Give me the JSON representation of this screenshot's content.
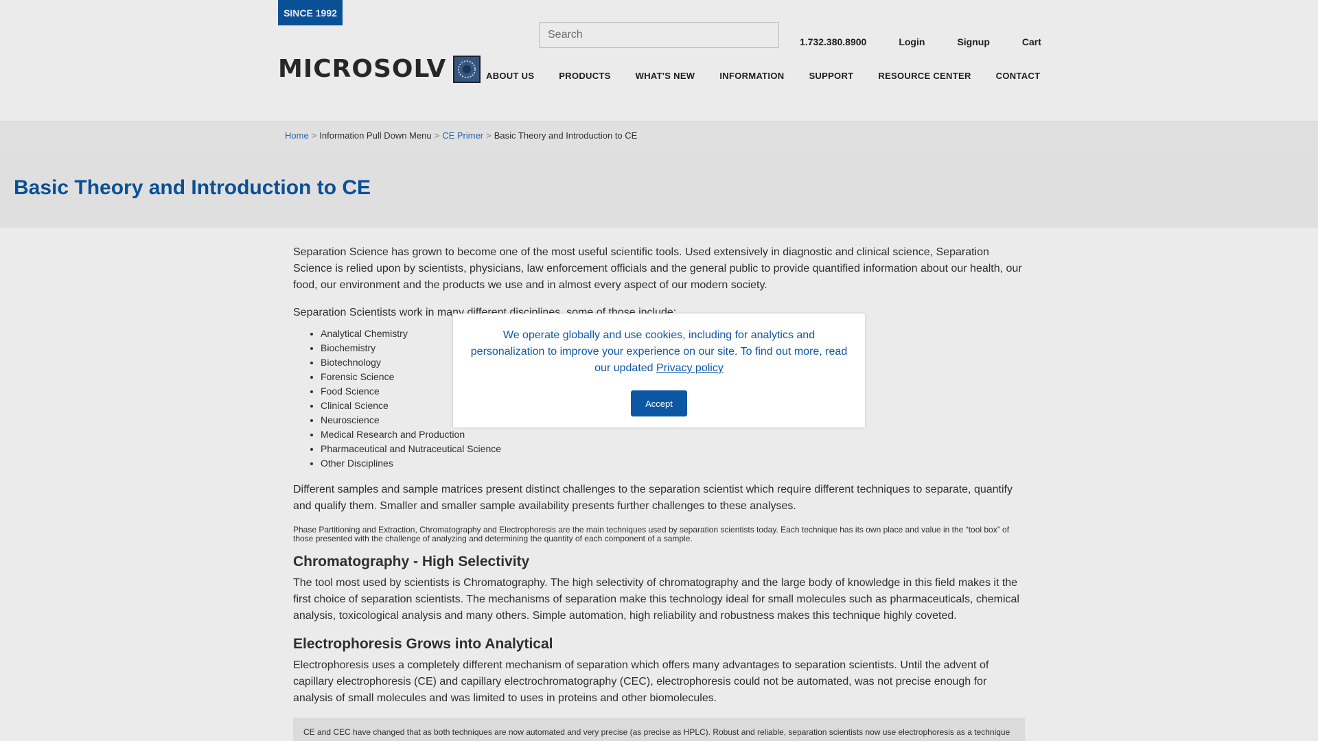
{
  "header": {
    "since_badge": "SINCE 1992",
    "logo_text": "MICROSOLV",
    "search_placeholder": "Search",
    "phone": "1.732.380.8900",
    "login": "Login",
    "signup": "Signup",
    "cart": "Cart",
    "nav": [
      "ABOUT US",
      "PRODUCTS",
      "WHAT'S NEW",
      "INFORMATION",
      "SUPPORT",
      "RESOURCE CENTER",
      "CONTACT"
    ]
  },
  "breadcrumb": {
    "home": "Home",
    "sep": ">",
    "item2": "Information Pull Down Menu",
    "item3": "CE Primer",
    "current": "Basic Theory and Introduction to CE"
  },
  "page_title": "Basic Theory and Introduction to CE",
  "content": {
    "p1": "Separation Science has grown to become one of the most useful scientific tools. Used extensively in diagnostic and clinical science, Separation Science is relied upon by scientists, physicians, law enforcement officials and the general public to provide quantified information about our health, our food, our environment and the products we use and in almost every aspect of our modern society.",
    "p2": "Separation Scientists work in many different disciplines, some of those include:",
    "disciplines": [
      "Analytical Chemistry",
      "Biochemistry",
      "Biotechnology",
      "Forensic Science",
      "Food Science",
      "Clinical Science",
      "Neuroscience",
      "Medical Research and Production",
      "Pharmaceutical and Nutraceutical Science",
      "Other Disciplines"
    ],
    "p3": "Different samples and sample matrices present distinct challenges to the separation scientist which require different techniques to separate, quantify and qualify them. Smaller and smaller sample availability presents further challenges to these analyses.",
    "p4": "Phase Partitioning and Extraction, Chromatography and Electrophoresis are the main techniques used by separation scientists today. Each technique has its own place and value in the “tool box” of those presented with the challenge of analyzing and determining the quantity of each component of a sample.",
    "h2a": "Chromatography - High Selectivity",
    "p5": "The tool most used by scientists is Chromatography. The high selectivity of chromatography and the large body of knowledge in this field makes it the first choice of separation scientists. The mechanisms of separation make this technology ideal for small molecules such as pharmaceuticals, chemical analysis, toxicological analysis and many others. Simple automation, high reliability and robustness makes this technique highly coveted.",
    "h2b": "Electrophoresis Grows into Analytical",
    "p6": "Electrophoresis uses a completely different mechanism of separation which offers many advantages to separation scientists. Until the advent of capillary electrophoresis (CE) and capillary electrochromatography (CEC), electrophoresis could not be automated, was not precise enough for analysis of small molecules and was limited to uses in proteins and other biomolecules.",
    "note": "CE and CEC have changed that as both techniques are now automated and very precise (as precise as HPLC). Robust and reliable, separation scientists now use electrophoresis as a technique"
  },
  "cookie": {
    "text": "We operate globally and use cookies, including for analytics and personalization to improve your experience on our site. To find out more, read our updated",
    "link": "Privacy policy",
    "accept": "Accept"
  },
  "colors": {
    "brand_blue": "#0b57a4",
    "link_blue": "#2a6db5"
  }
}
